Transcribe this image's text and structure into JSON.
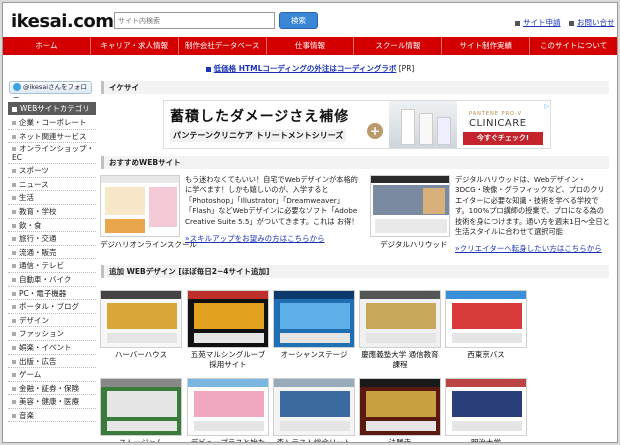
{
  "header": {
    "logo_text": "ikesai.com",
    "search_placeholder": "サイト内検索",
    "search_button": "検索",
    "links": [
      "サイト申請",
      "お問い合せ"
    ]
  },
  "nav": [
    "ホーム",
    "キャリア・求人情報",
    "制作会社データベース",
    "仕事情報",
    "スクール情報",
    "サイト制作実績",
    "このサイトについて"
  ],
  "promo": {
    "text": "低価格 HTMLコーディングの外注はコーディングラボ",
    "suffix": "[PR]"
  },
  "sidebar": {
    "follow_label": "@ikesaiさんをフォロー",
    "category_title": "WEBサイトカテゴリ",
    "categories": [
      "企業・コーポレート",
      "ネット関連サービス",
      "オンラインショップ・EC",
      "スポーツ",
      "ニュース",
      "生活",
      "教育・学校",
      "飲・食",
      "旅行・交通",
      "流通・販売",
      "通信・テレビ",
      "自動車・バイク",
      "PC・電子機器",
      "ポータル・ブログ",
      "デザイン",
      "ファッション",
      "娯楽・イベント",
      "出版・広告",
      "ゲーム",
      "金融・証券・保険",
      "美容・健康・医療",
      "音楽"
    ]
  },
  "sections": {
    "ikesai": "イケサイ",
    "recommended": "おすすめWEBサイト",
    "added": "追加 WEBデザイン [ほぼ毎日2~4サイト追加]"
  },
  "ad": {
    "title": "蓄積したダメージさえ補修",
    "subtitle": "パンテーンクリニケア トリートメントシリーズ",
    "brand": "PANTENE PRO-V",
    "product": "CLINICARE",
    "cta": "今すぐチェック!",
    "badge": "▷"
  },
  "recommended": [
    {
      "name": "デジハリオンラインスクール",
      "desc": "もう迷わなくてもいい！自宅でWebデザインが本格的に学べます！しかも嬉しいのが、入学すると「Photoshop」「Illustrator」「Dreamweaver」「Flash」などWebデザインに必要なソフト「Adobe Creative Suite 5.5」がついてきます。これは お得！",
      "link": "»スキルアップをお望みの方はこちらから"
    },
    {
      "name": "デジタルハリウッド",
      "desc": "デジタルハリウッドは、Webデザイン・3DCG・映像・グラフィックなど、プロのクリエイターに必要な知識・技術を学べる学校です。100%プロ講師の授業で、プロになる為の技術を身につけます。通い方を週末1日～全日と生活スタイルに合わせて選択可能",
      "link": "»クリエイターへ転身したい方はこちらから"
    }
  ],
  "gallery": [
    {
      "label": "ハーバーハウス",
      "colors": [
        "#f7f7f7",
        "#d9a63a",
        "#444"
      ]
    },
    {
      "label": "五苑マルシングルーブ採用サイト",
      "colors": [
        "#111",
        "#e0a020",
        "#c0302a"
      ]
    },
    {
      "label": "オーシャンステージ",
      "colors": [
        "#1f6fb2",
        "#5fb0e8",
        "#0c3a6a"
      ]
    },
    {
      "label": "慶應義塾大学 通信教育課程",
      "colors": [
        "#f0f0f0",
        "#c8a85a",
        "#555"
      ]
    },
    {
      "label": "西東京バス",
      "colors": [
        "#fff",
        "#d93a3a",
        "#3a8fd9"
      ]
    },
    {
      "label": "ストージャム",
      "colors": [
        "#3a7a3a",
        "#e5e5e5",
        "#888"
      ]
    },
    {
      "label": "デビュープラスと始た",
      "colors": [
        "#fdfdfd",
        "#f2a7c0",
        "#7ab6e0"
      ]
    },
    {
      "label": "森トラスト総合リート投",
      "colors": [
        "#f4f4f4",
        "#3b6aa0",
        "#9ab"
      ]
    },
    {
      "label": "法勝寺",
      "colors": [
        "#5a1a10",
        "#c9a040",
        "#1a1a1a"
      ]
    },
    {
      "label": "明治大学",
      "colors": [
        "#fff",
        "#2a3f7a",
        "#b44"
      ]
    }
  ]
}
